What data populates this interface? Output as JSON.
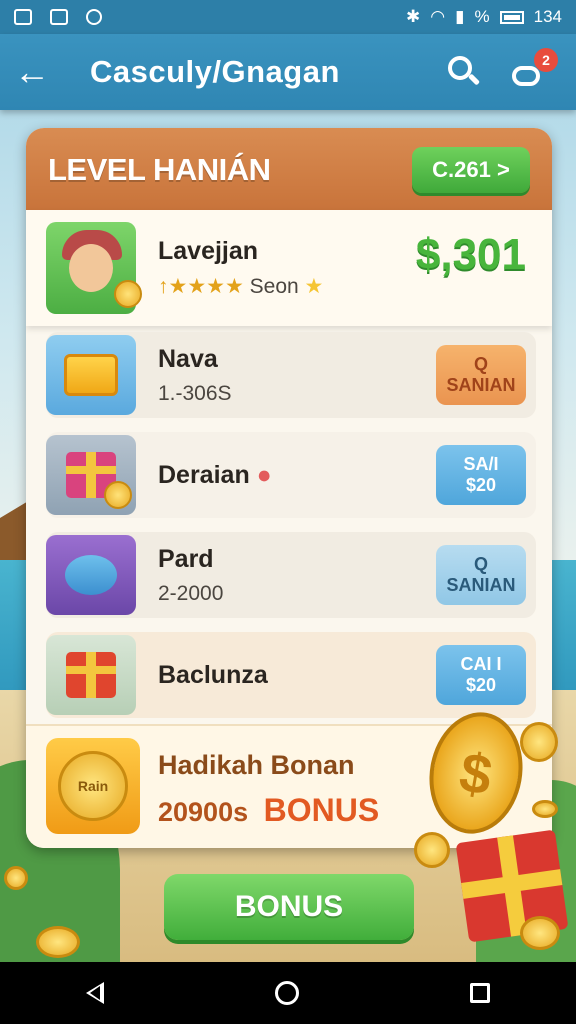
{
  "status_bar": {
    "time": "134",
    "battery": "%"
  },
  "app_bar": {
    "title": "Casculy/Gnagan",
    "notification_count": "2"
  },
  "panel": {
    "title": "LEVEL HANIÁN",
    "header_button": "C.261 >"
  },
  "featured": {
    "name": "Lavejjan",
    "sub": "Seon",
    "prize": "$,301"
  },
  "items": [
    {
      "name": "Nava",
      "sub": "1.-306S",
      "action_line1": "Q",
      "action_line2": "SANIAN"
    },
    {
      "name": "Deraian",
      "sub": "",
      "action_line1": "SA/I",
      "action_line2": "$20"
    },
    {
      "name": "Pard",
      "sub": "2-2000",
      "action_line1": "Q",
      "action_line2": "SANIAN"
    },
    {
      "name": "Baclunza",
      "sub": "",
      "action_line1": "CAI I",
      "action_line2": "$20"
    }
  ],
  "bonus_card": {
    "name": "Hadikah Bonan",
    "amount": "20900s",
    "highlight": "BONUS",
    "coin_label": "Rain"
  },
  "bonus_button": "BONUS",
  "colors": {
    "status_bar": "#2d7fa8",
    "app_bar": "#3a93bf",
    "panel_header": "#d98c52",
    "green": "#48b53c",
    "orange_action": "#ea9450",
    "blue_action": "#4fa6db"
  }
}
